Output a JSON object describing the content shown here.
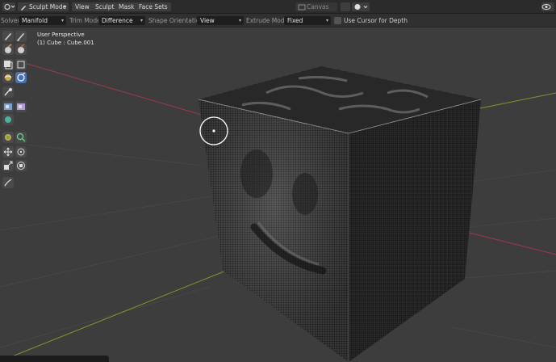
{
  "header": {
    "mode_label": "Sculpt Mode",
    "menus": [
      "View",
      "Sculpt",
      "Mask",
      "Face Sets"
    ],
    "canvas_label": "Canvas"
  },
  "tool_options": {
    "solver_label": "Solver:",
    "solver_value": "Manifold",
    "trim_mode_label": "Trim Mode:",
    "trim_mode_value": "Difference",
    "shape_orientation_label": "Shape Orientation:",
    "shape_orientation_value": "View",
    "extrude_mode_label": "Extrude Mode:",
    "extrude_mode_value": "Fixed",
    "use_cursor_label": "Use Cursor for Depth"
  },
  "viewport": {
    "view_name": "User Perspective",
    "object_info": "(1) Cube : Cube.001"
  },
  "toolbar": {
    "tools": [
      "draw-brush",
      "draw-sharp-brush",
      "clay-brush",
      "clay-strips-brush",
      "layer-brush",
      "box-trim",
      "lasso-trim",
      "smooth-brush",
      "mask-brush",
      "face-set-brush",
      "cloth-brush",
      "simplify-brush",
      "mesh-filter",
      "transform",
      "move",
      "rotate",
      "scale",
      "line-project",
      "annotate"
    ]
  },
  "colors": {
    "accent_active": "#4772b3",
    "x_axis": "#9b3a4a",
    "y_axis": "#7a9a2a"
  }
}
